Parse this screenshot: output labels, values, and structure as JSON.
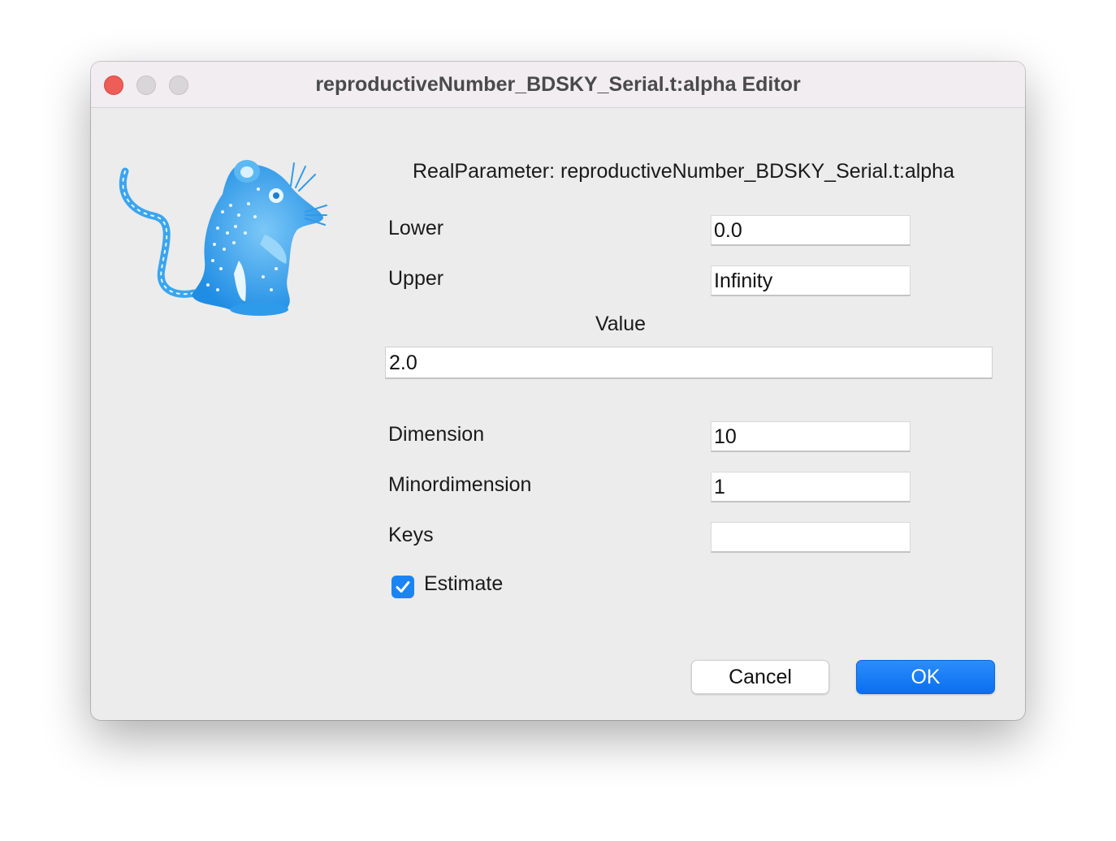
{
  "window": {
    "title": "reproductiveNumber_BDSKY_Serial.t:alpha Editor",
    "controls": [
      "close",
      "minimize",
      "zoom"
    ]
  },
  "logo": {
    "icon": "beast-mouse-logo-icon",
    "color": "#3aa5ef"
  },
  "editor": {
    "header": "RealParameter: reproductiveNumber_BDSKY_Serial.t:alpha",
    "lower": {
      "label": "Lower",
      "value": "0.0"
    },
    "upper": {
      "label": "Upper",
      "value": "Infinity"
    },
    "value": {
      "label": "Value",
      "value": "2.0"
    },
    "dimension": {
      "label": "Dimension",
      "value": "10"
    },
    "minordimension": {
      "label": "Minordimension",
      "value": "1"
    },
    "keys": {
      "label": "Keys",
      "value": ""
    },
    "estimate": {
      "label": "Estimate",
      "checked": true
    }
  },
  "buttons": {
    "cancel": "Cancel",
    "ok": "OK"
  },
  "colors": {
    "accent": "#1a84f5",
    "close": "#ee5e57",
    "window_bg": "#ececec"
  }
}
